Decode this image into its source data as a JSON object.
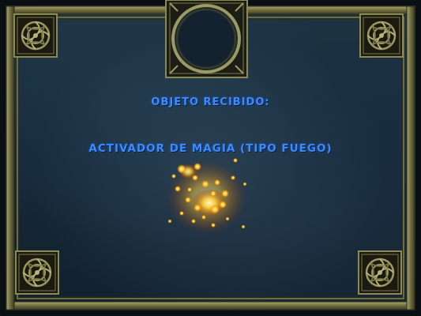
{
  "dialog": {
    "header": "OBJETO RECIBIDO:",
    "item_name": "ACTIVADOR  DE MAGIA (TIPO FUEGO)"
  },
  "colors": {
    "text_blue": "#3a8cff",
    "frame_gold": "#8a8a52",
    "frame_dark": "#2c2c18",
    "background": "#16293a",
    "fire_core": "#fff3a0",
    "fire_glow": "#ffb000"
  },
  "icons": {
    "item_icon": "fire-magic-particles-icon",
    "corner_ornament": "celtic-knot-ornament-icon",
    "top_medallion": "circular-medallion-icon"
  }
}
